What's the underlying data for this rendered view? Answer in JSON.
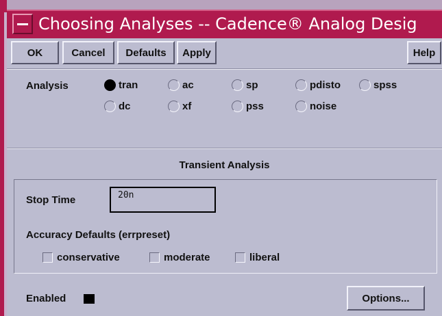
{
  "window": {
    "title": "Choosing Analyses -- Cadence® Analog Desig"
  },
  "toolbar": {
    "ok": "OK",
    "cancel": "Cancel",
    "defaults": "Defaults",
    "apply": "Apply",
    "help": "Help"
  },
  "analysis": {
    "label": "Analysis",
    "selected": "tran",
    "options": [
      "tran",
      "ac",
      "sp",
      "pdisto",
      "spss",
      "dc",
      "xf",
      "pss",
      "noise"
    ]
  },
  "transient": {
    "section_title": "Transient Analysis",
    "stop_time_label": "Stop Time",
    "stop_time_value": "20n",
    "accuracy_label": "Accuracy Defaults (errpreset)",
    "accuracy_options": [
      "conservative",
      "moderate",
      "liberal"
    ]
  },
  "footer": {
    "enabled_label": "Enabled",
    "enabled_checked": true,
    "options_button": "Options..."
  }
}
